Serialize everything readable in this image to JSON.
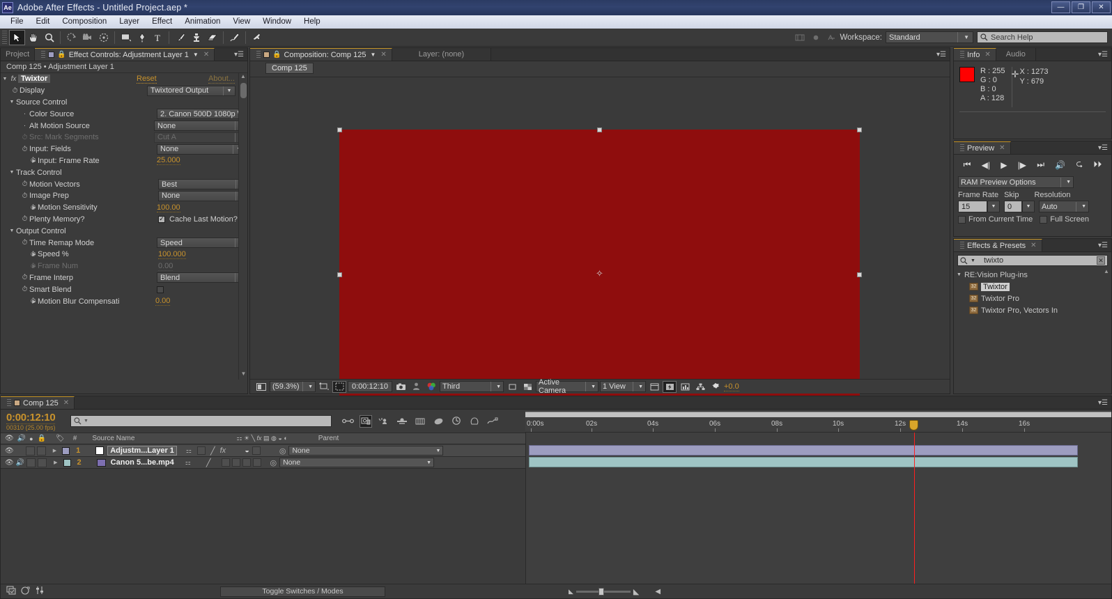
{
  "window": {
    "app_icon": "Ae",
    "title": "Adobe After Effects - Untitled Project.aep *",
    "minimize": "—",
    "restore": "❐",
    "close": "✕"
  },
  "menu": [
    "File",
    "Edit",
    "Composition",
    "Layer",
    "Effect",
    "Animation",
    "View",
    "Window",
    "Help"
  ],
  "toolbar": {
    "tools": [
      {
        "name": "selection-tool",
        "glyph": "➤",
        "selected": true
      },
      {
        "name": "hand-tool",
        "glyph": "✋",
        "selected": false
      },
      {
        "name": "zoom-tool",
        "glyph": "🔍",
        "selected": false
      },
      {
        "name": "rotation-tool",
        "glyph": "↻",
        "selected": false
      },
      {
        "name": "camera-tool",
        "glyph": "🎥",
        "selected": false
      },
      {
        "name": "pan-behind-tool",
        "glyph": "✥",
        "selected": false
      },
      {
        "name": "shape-tool",
        "glyph": "▭",
        "selected": false
      },
      {
        "name": "pen-tool",
        "glyph": "✒",
        "selected": false
      },
      {
        "name": "type-tool",
        "glyph": "T",
        "selected": false
      },
      {
        "name": "brush-tool",
        "glyph": "🖌",
        "selected": false
      },
      {
        "name": "clone-stamp-tool",
        "glyph": "⚱",
        "selected": false
      },
      {
        "name": "eraser-tool",
        "glyph": "▱",
        "selected": false
      },
      {
        "name": "roto-brush-tool",
        "glyph": "✎",
        "selected": false
      },
      {
        "name": "puppet-pin-tool",
        "glyph": "📌",
        "selected": false
      }
    ],
    "workspace_label": "Workspace:",
    "workspace_value": "Standard",
    "search_help_placeholder": "Search Help"
  },
  "effect_controls": {
    "tabs": [
      {
        "label": "Project",
        "active": false
      },
      {
        "label": "Effect Controls: Adjustment Layer 1",
        "active": true
      }
    ],
    "header": "Comp 125 • Adjustment Layer 1",
    "effect_name": "Twixtor",
    "reset_label": "Reset",
    "about_label": "About...",
    "rows": [
      {
        "name": "Display",
        "type": "combo",
        "value": "Twixtored Output",
        "indent": 2,
        "stopwatch": true,
        "disabled": false
      },
      {
        "name": "Source Control",
        "type": "group",
        "indent": 1
      },
      {
        "name": "Color Source",
        "type": "combo",
        "value": "2. Canon 500D 1080p \\",
        "indent": 3,
        "stopwatch": false,
        "disabled": false
      },
      {
        "name": "Alt Motion Source",
        "type": "combo",
        "value": "None",
        "indent": 3,
        "stopwatch": false,
        "disabled": false
      },
      {
        "name": "Src: Mark Segments",
        "type": "combo",
        "value": "Cut A",
        "indent": 3,
        "stopwatch": true,
        "disabled": true
      },
      {
        "name": "Input: Fields",
        "type": "combo",
        "value": "None",
        "indent": 3,
        "stopwatch": true,
        "disabled": false
      },
      {
        "name": "Input: Frame Rate",
        "type": "number",
        "value": "25.000",
        "indent": 3,
        "stopwatch": true,
        "twirl": true,
        "disabled": false
      },
      {
        "name": "Track Control",
        "type": "group",
        "indent": 1
      },
      {
        "name": "Motion Vectors",
        "type": "combo",
        "value": "Best",
        "indent": 3,
        "stopwatch": true,
        "disabled": false
      },
      {
        "name": "Image Prep",
        "type": "combo",
        "value": "None",
        "indent": 3,
        "stopwatch": true,
        "disabled": false
      },
      {
        "name": "Motion Sensitivity",
        "type": "number",
        "value": "100.00",
        "indent": 3,
        "stopwatch": true,
        "twirl": true,
        "disabled": false
      },
      {
        "name": "Plenty Memory?",
        "type": "checkbox-label",
        "value": "Cache Last Motion?",
        "checked": true,
        "indent": 3,
        "stopwatch": true,
        "disabled": false
      },
      {
        "name": "Output Control",
        "type": "group",
        "indent": 1
      },
      {
        "name": "Time Remap Mode",
        "type": "combo",
        "value": "Speed",
        "indent": 3,
        "stopwatch": true,
        "disabled": false
      },
      {
        "name": "Speed %",
        "type": "number",
        "value": "100.000",
        "indent": 3,
        "stopwatch": true,
        "twirl": true,
        "disabled": false
      },
      {
        "name": "Frame Num",
        "type": "number",
        "value": "0.00",
        "indent": 3,
        "stopwatch": true,
        "twirl": true,
        "disabled": true
      },
      {
        "name": "Frame Interp",
        "type": "combo",
        "value": "Blend",
        "indent": 3,
        "stopwatch": true,
        "disabled": false
      },
      {
        "name": "Smart Blend",
        "type": "checkbox",
        "checked": false,
        "indent": 3,
        "stopwatch": true,
        "disabled": false
      },
      {
        "name": "Motion Blur Compensati",
        "type": "number",
        "value": "0.00",
        "indent": 3,
        "stopwatch": true,
        "twirl": true,
        "disabled": false
      }
    ]
  },
  "composition": {
    "tabs": [
      {
        "label": "Composition: Comp 125",
        "active": true
      },
      {
        "label": "Layer: (none)",
        "active": false
      }
    ],
    "subtab": "Comp 125",
    "frame_color": "#8f0d0d",
    "footer": {
      "zoom": "(59.3%)",
      "time": "0:00:12:10",
      "resolution": "Third",
      "camera": "Active Camera",
      "views": "1 View",
      "exposure": "+0.0"
    }
  },
  "info": {
    "tabs": [
      {
        "label": "Info",
        "active": true
      },
      {
        "label": "Audio",
        "active": false
      }
    ],
    "swatch_color": "#ff0000",
    "r_label": "R :",
    "r_value": "255",
    "g_label": "G :",
    "g_value": "0",
    "b_label": "B :",
    "b_value": "0",
    "a_label": "A :",
    "a_value": "128",
    "x_label": "X :",
    "x_value": "1273",
    "y_label": "Y :",
    "y_value": "679"
  },
  "preview": {
    "tabs": [
      {
        "label": "Preview",
        "active": true
      }
    ],
    "buttons": [
      "first-frame",
      "previous-frame",
      "play",
      "next-frame",
      "last-frame",
      "audio",
      "loop",
      "ram-preview"
    ],
    "ram_preview_options": "RAM Preview Options",
    "frame_rate_label": "Frame Rate",
    "frame_rate_value": "15",
    "skip_label": "Skip",
    "skip_value": "0",
    "resolution_label": "Resolution",
    "resolution_value": "Auto",
    "from_current_time": "From Current Time",
    "full_screen": "Full Screen"
  },
  "effects_presets": {
    "tabs": [
      {
        "label": "Effects & Presets",
        "active": true
      }
    ],
    "search_value": "twixto",
    "group": "RE:Vision Plug-ins",
    "items": [
      {
        "label": "Twixtor",
        "selected": true
      },
      {
        "label": "Twixtor Pro",
        "selected": false
      },
      {
        "label": "Twixtor Pro, Vectors In",
        "selected": false
      }
    ]
  },
  "timeline": {
    "tabs": [
      {
        "label": "Comp 125",
        "active": true
      }
    ],
    "timecode": "0:00:12:10",
    "frames": "00310 (25.00 fps)",
    "search_placeholder": "",
    "columns": [
      "#",
      "Source Name",
      "Parent"
    ],
    "toggle_switches_modes": "Toggle Switches / Modes",
    "ruler_ticks": [
      "0:00s",
      "02s",
      "04s",
      "06s",
      "08s",
      "10s",
      "12s",
      "14s",
      "16s"
    ],
    "layers": [
      {
        "index": "1",
        "name": "Adjustm...Layer 1",
        "selected": true,
        "audio": false,
        "swatch": "#9d9dc0",
        "parent": "None",
        "has_fx": true
      },
      {
        "index": "2",
        "name": "Canon 5...be.mp4",
        "selected": false,
        "audio": true,
        "swatch": "#9fc4c4",
        "parent": "None",
        "has_fx": false
      }
    ]
  }
}
